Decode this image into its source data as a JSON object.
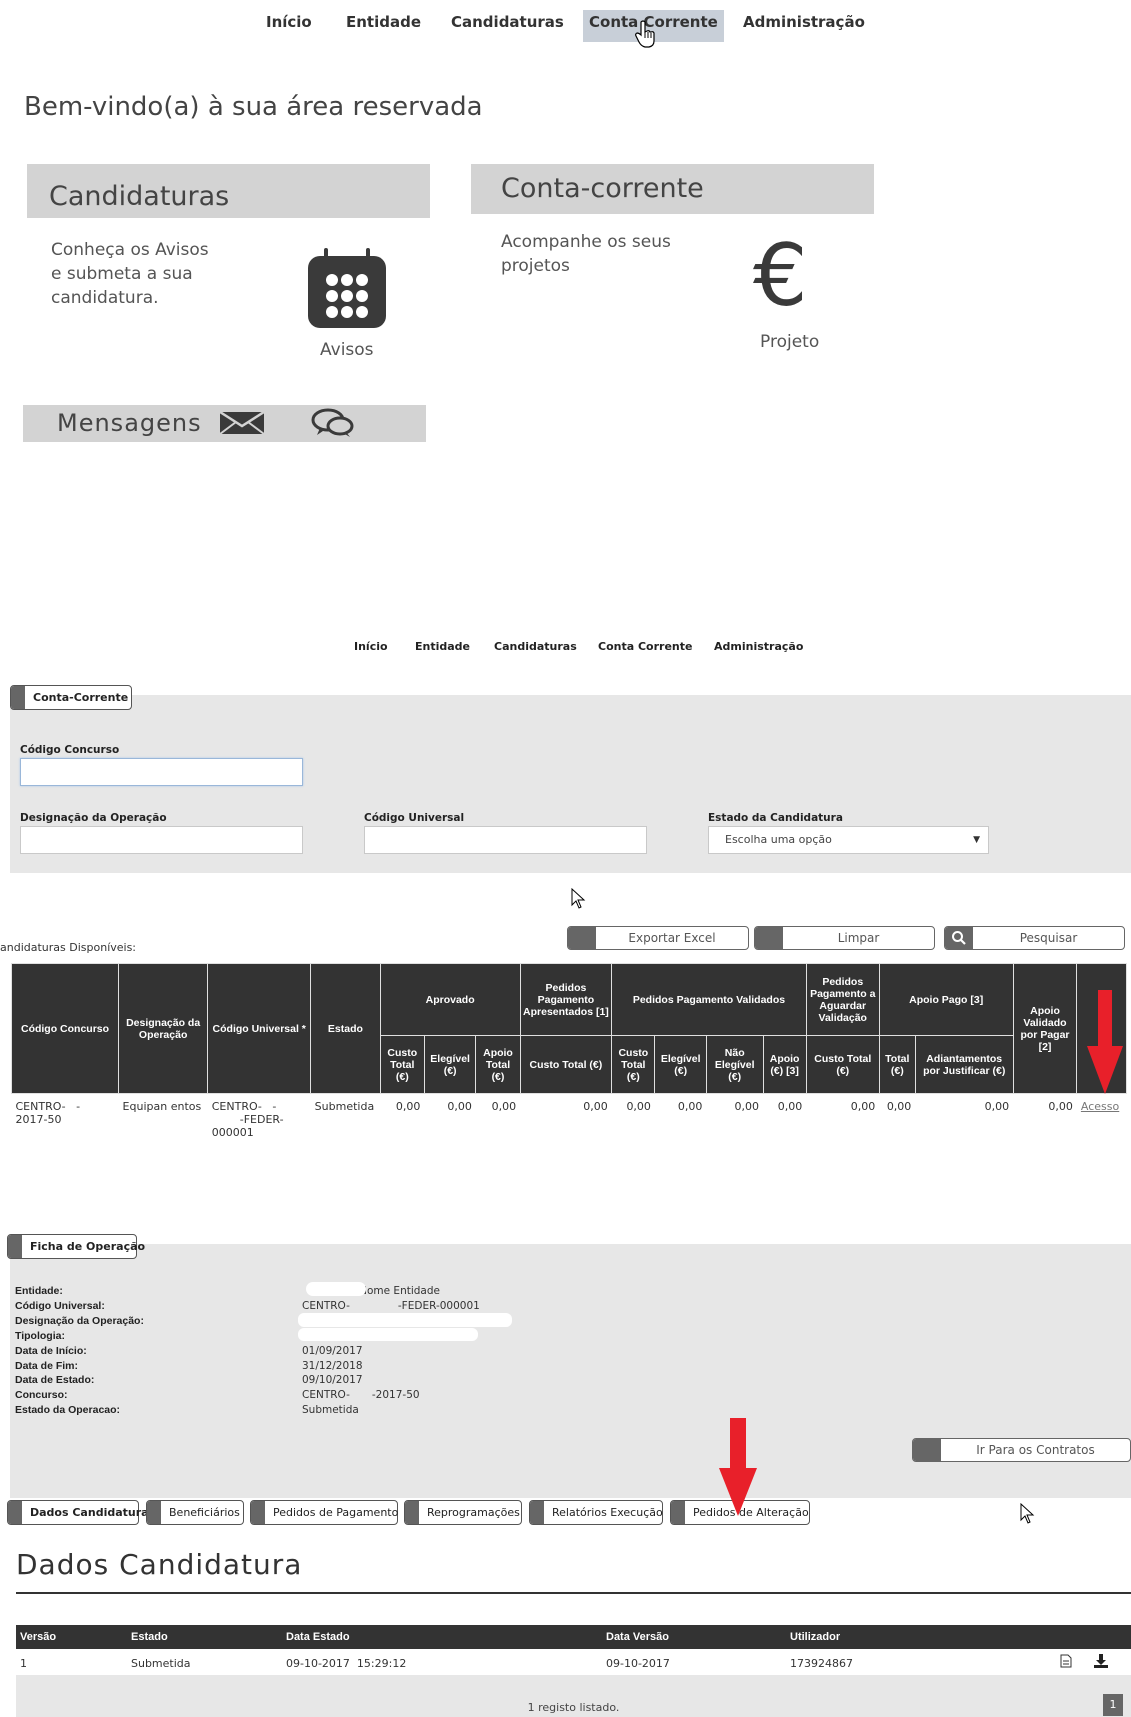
{
  "nav": {
    "items": [
      "Início",
      "Entidade",
      "Candidaturas",
      "Conta Corrente",
      "Administração"
    ]
  },
  "welcome": {
    "title": "Bem-vindo(a) à sua área reservada"
  },
  "tiles": {
    "candidaturas": {
      "title": "Candidaturas",
      "text_line1": "Conheça os Avisos",
      "text_line2": "e submeta a sua",
      "text_line3": "candidatura.",
      "caption": "Avisos",
      "icon": "calendar-icon"
    },
    "conta": {
      "title": "Conta-corrente",
      "text_line1": "Acompanhe os seus",
      "text_line2": "projetos",
      "caption": "Projeto",
      "symbol": "€",
      "icon": "euro-icon"
    },
    "mensagens": {
      "title": "Mensagens",
      "icons": [
        "envelope-icon",
        "chat-bubbles-icon"
      ]
    }
  },
  "conta_corrente": {
    "tab_label": "Conta-Corrente",
    "fields": {
      "codigo_concurso": {
        "label": "Código Concurso",
        "value": ""
      },
      "designacao": {
        "label": "Designação da Operação",
        "value": ""
      },
      "codigo_universal": {
        "label": "Código Universal",
        "value": ""
      },
      "estado": {
        "label": "Estado da Candidatura",
        "selected": "Escolha uma opção"
      }
    },
    "buttons": {
      "export": "Exportar Excel",
      "clear": "Limpar",
      "search": "Pesquisar"
    },
    "available_label": "andidaturas Disponíveis:",
    "table": {
      "headers": {
        "codigo_concurso": "Código Concurso",
        "designacao": "Designação da Operação",
        "codigo_universal": "Código Universal *",
        "estado": "Estado",
        "aprovado": "Aprovado",
        "pedidos_apresentados": "Pedidos Pagamento Apresentados [1]",
        "pedidos_validados": "Pedidos Pagamento Validados",
        "pedidos_aguardar": "Pedidos Pagamento a Aguardar Validação",
        "apoio_pago": "Apoio Pago [3]",
        "apoio_validado": "Apoio Validado por Pagar [2]",
        "acesso": "",
        "sub_custo_total": "Custo Total (€)",
        "sub_elegivel": "Elegível (€)",
        "sub_apoio_total": "Apoio Total (€)",
        "sub_custo_total2": "Custo Total (€)",
        "sub_custo_total3": "Custo Total (€)",
        "sub_elegivel2": "Elegível (€)",
        "sub_nao_elegivel": "Não Elegível (€)",
        "sub_apoio3": "Apoio (€) [3]",
        "sub_custo_total4": "Custo Total (€)",
        "sub_total": "Total (€)",
        "sub_adiantamentos": "Adiantamentos por Justificar (€)"
      },
      "row": {
        "codigo_concurso_l1": "CENTRO-",
        "codigo_concurso_l1b": "-",
        "codigo_concurso_l2": "2017-50",
        "designacao": "Equipan",
        "designacao_b": "entos",
        "codigo_universal_l1": "CENTRO-",
        "codigo_universal_l1b": "-",
        "codigo_universal_l2": "-FEDER-",
        "codigo_universal_l3": "000001",
        "estado": "Submetida",
        "values": [
          "0,00",
          "0,00",
          "0,00",
          "0,00",
          "0,00",
          "0,00",
          "0,00",
          "0,00",
          "0,00",
          "0,00",
          "0,00",
          "0,00"
        ],
        "acesso": "Acesso"
      }
    }
  },
  "ficha": {
    "tab_label": "Ficha de Operação",
    "rows": [
      {
        "label": "Entidade:",
        "value": "- Nome Entidade"
      },
      {
        "label": "Código Universal:",
        "value": "CENTRO-",
        "value_b": "-FEDER-000001"
      },
      {
        "label": "Designação da Operação:",
        "value": ""
      },
      {
        "label": "Tipologia:",
        "value": ""
      },
      {
        "label": "Data de Início:",
        "value": "01/09/2017"
      },
      {
        "label": "Data de Fim:",
        "value": "31/12/2018"
      },
      {
        "label": "Data de Estado:",
        "value": "09/10/2017"
      },
      {
        "label": "Concurso:",
        "value": "CENTRO-",
        "value_b": "-2017-50"
      },
      {
        "label": "Estado da Operacao:",
        "value": "Submetida"
      }
    ],
    "contracts_button": "Ir Para os Contratos",
    "tabs": [
      "Dados Candidatura",
      "Beneficiários",
      "Pedidos de Pagamento",
      "Reprogramações",
      "Relatórios Execução",
      "Pedidos de Alteração"
    ]
  },
  "dados": {
    "title": "Dados Candidatura",
    "headers": [
      "Versão",
      "Estado",
      "Data Estado",
      "Data Versão",
      "Utilizador"
    ],
    "row": [
      "1",
      "Submetida",
      "09-10-2017  15:29:12",
      "09-10-2017",
      "173924867"
    ],
    "row_icons": [
      "document-icon",
      "download-icon"
    ],
    "count_text": "1 registo listado.",
    "page": "1"
  },
  "colors": {
    "header_dark": "#333333",
    "panel_grey": "#e7e7e7",
    "tile_grey": "#d3d3d3",
    "arrow_red": "#e8202a"
  }
}
